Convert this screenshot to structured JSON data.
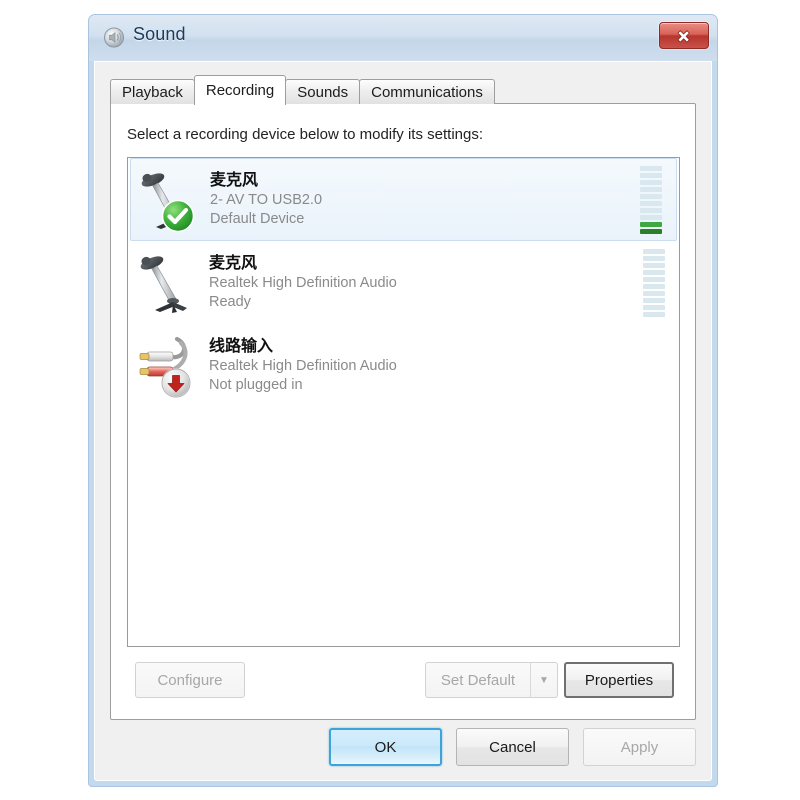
{
  "window": {
    "title": "Sound",
    "icon": "sound-speaker-icon",
    "close_label": "Close"
  },
  "tabs": [
    {
      "label": "Playback",
      "active": false
    },
    {
      "label": "Recording",
      "active": true
    },
    {
      "label": "Sounds",
      "active": false
    },
    {
      "label": "Communications",
      "active": false
    }
  ],
  "panel": {
    "instruction": "Select a recording device below to modify its settings:"
  },
  "devices": [
    {
      "name": "麦克风",
      "driver": "2- AV TO USB2.0",
      "status": "Default Device",
      "icon": "desk-microphone-icon",
      "badge": "green-check-badge",
      "selected": true,
      "meter_segments": 10,
      "meter_lit": 2
    },
    {
      "name": "麦克风",
      "driver": "Realtek High Definition Audio",
      "status": "Ready",
      "icon": "desk-microphone-icon",
      "badge": "none",
      "selected": false,
      "meter_segments": 10,
      "meter_lit": 0
    },
    {
      "name": "线路输入",
      "driver": "Realtek High Definition Audio",
      "status": "Not plugged in",
      "icon": "rca-cable-icon",
      "badge": "red-down-arrow-badge",
      "selected": false,
      "meter_segments": 0,
      "meter_lit": 0
    }
  ],
  "mid_buttons": {
    "configure": {
      "label": "Configure",
      "enabled": false
    },
    "set_default": {
      "label": "Set Default",
      "enabled": false
    },
    "set_default_arrow": {
      "label": "▼",
      "enabled": false
    },
    "properties": {
      "label": "Properties",
      "enabled": true
    }
  },
  "action_buttons": {
    "ok": {
      "label": "OK",
      "enabled": true,
      "default": true
    },
    "cancel": {
      "label": "Cancel",
      "enabled": true
    },
    "apply": {
      "label": "Apply",
      "enabled": false
    }
  },
  "colors": {
    "accent": "#3fa2d8",
    "frame": "#bed6ec",
    "meter_lit_light": "#3fa93f",
    "meter_lit_dark": "#2b7f28",
    "meter_unlit": "#d9e7ef",
    "close_red": "#b6352e",
    "selection": "#eaf3fb"
  }
}
